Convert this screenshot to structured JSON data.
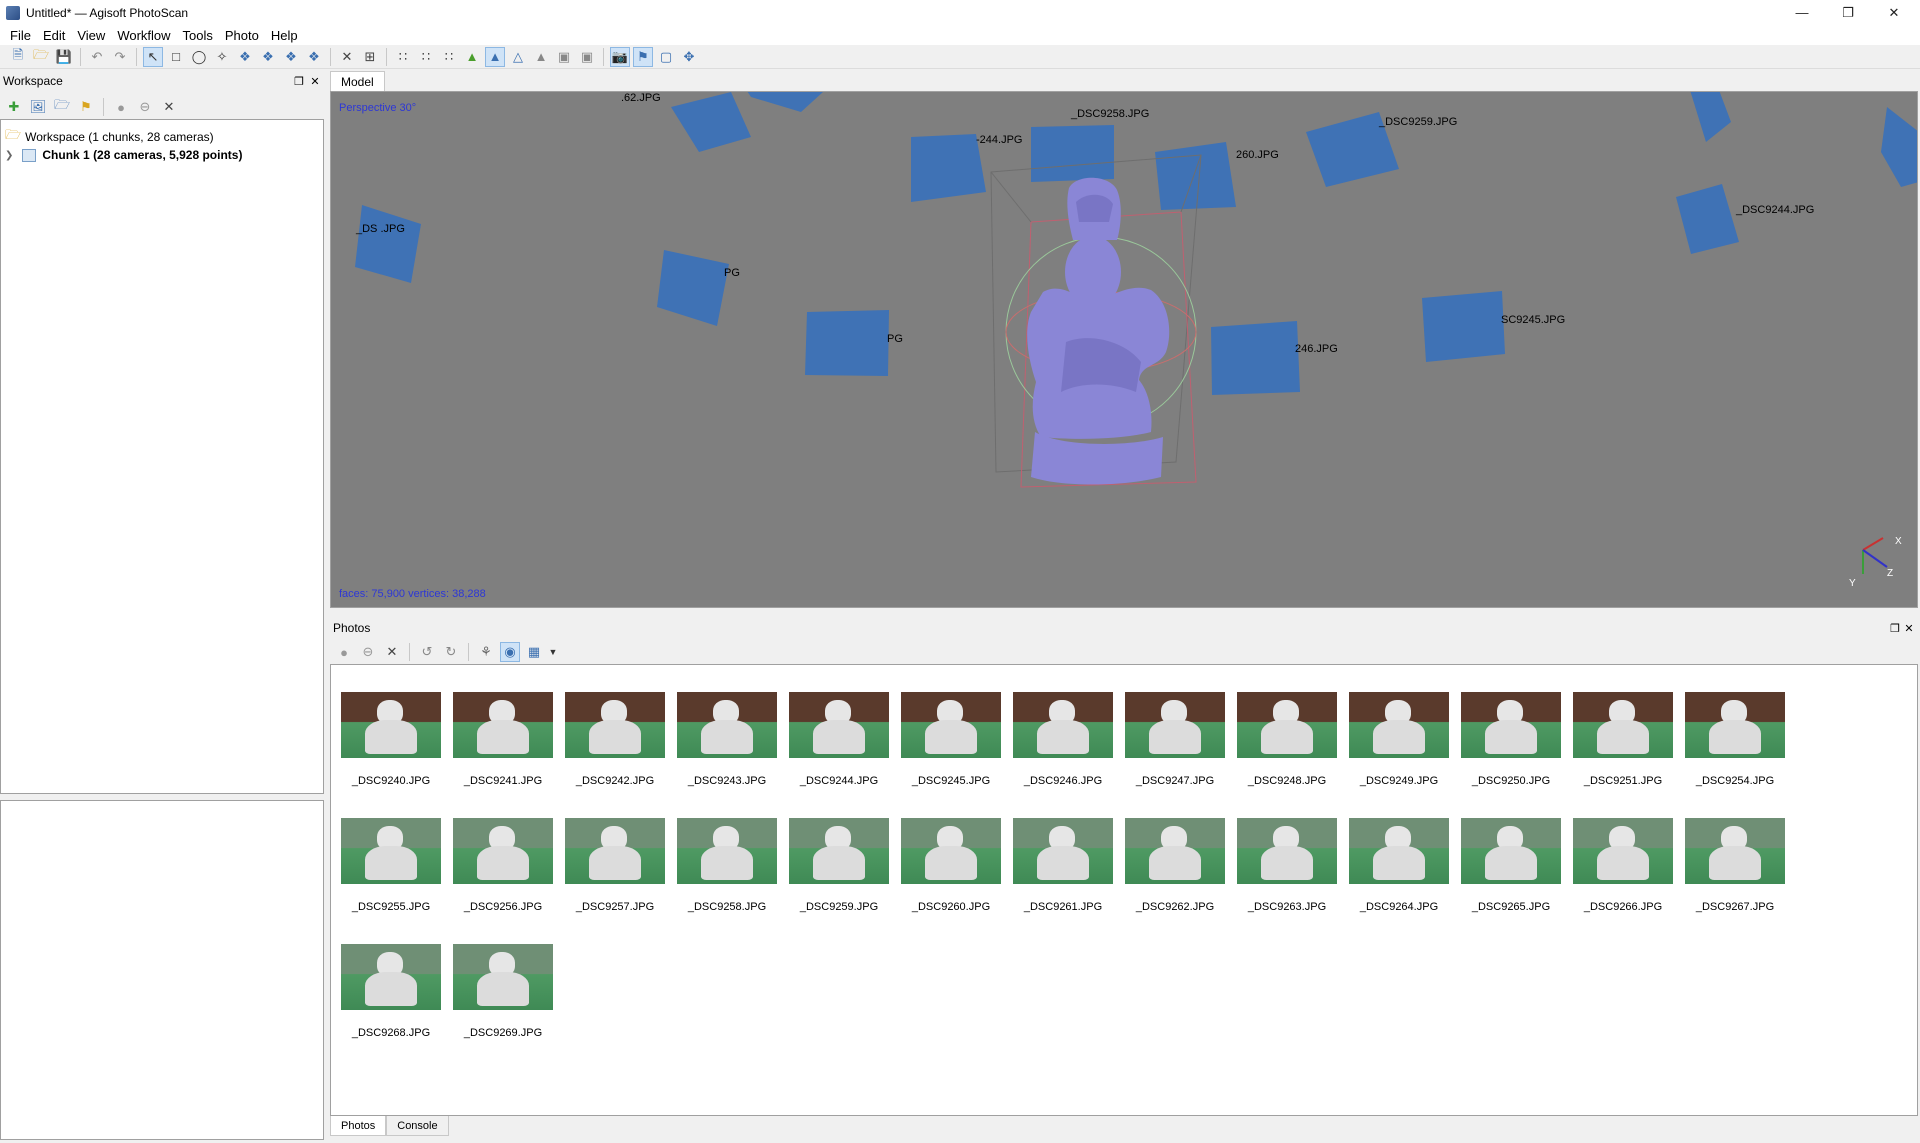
{
  "window": {
    "title": "Untitled* — Agisoft PhotoScan"
  },
  "menu": [
    "File",
    "Edit",
    "View",
    "Workflow",
    "Tools",
    "Photo",
    "Help"
  ],
  "workspace": {
    "title": "Workspace",
    "root_label": "Workspace (1 chunks, 28 cameras)",
    "chunk_label": "Chunk 1 (28 cameras, 5,928 points)"
  },
  "model": {
    "tab_label": "Model",
    "projection": "Perspective 30°",
    "stats": "faces: 75,900 vertices: 38,288",
    "axis_labels": {
      "x": "X",
      "y": "Y",
      "z": "Z"
    },
    "camera_labels": [
      ".62.JPG",
      "-244.JPG",
      "_DSC9258.JPG",
      "260.JPG",
      "_DSC9259.JPG",
      "_DSC9244.JPG",
      "_DS  .JPG",
      "PG",
      "PG",
      "246.JPG",
      "SC9245.JPG"
    ]
  },
  "photos": {
    "title": "Photos",
    "items": [
      "_DSC9240.JPG",
      "_DSC9241.JPG",
      "_DSC9242.JPG",
      "_DSC9243.JPG",
      "_DSC9244.JPG",
      "_DSC9245.JPG",
      "_DSC9246.JPG",
      "_DSC9247.JPG",
      "_DSC9248.JPG",
      "_DSC9249.JPG",
      "_DSC9250.JPG",
      "_DSC9251.JPG",
      "_DSC9254.JPG",
      "_DSC9255.JPG",
      "_DSC9256.JPG",
      "_DSC9257.JPG",
      "_DSC9258.JPG",
      "_DSC9259.JPG",
      "_DSC9260.JPG",
      "_DSC9261.JPG",
      "_DSC9262.JPG",
      "_DSC9263.JPG",
      "_DSC9264.JPG",
      "_DSC9265.JPG",
      "_DSC9266.JPG",
      "_DSC9267.JPG",
      "_DSC9268.JPG",
      "_DSC9269.JPG"
    ]
  },
  "bottom_tabs": [
    "Photos",
    "Console"
  ],
  "colors": {
    "viewport_bg": "#7f7f7f",
    "camera_plane": "#3f72b5",
    "model": "#8a86d6",
    "overlay_text": "#2d37d6"
  }
}
